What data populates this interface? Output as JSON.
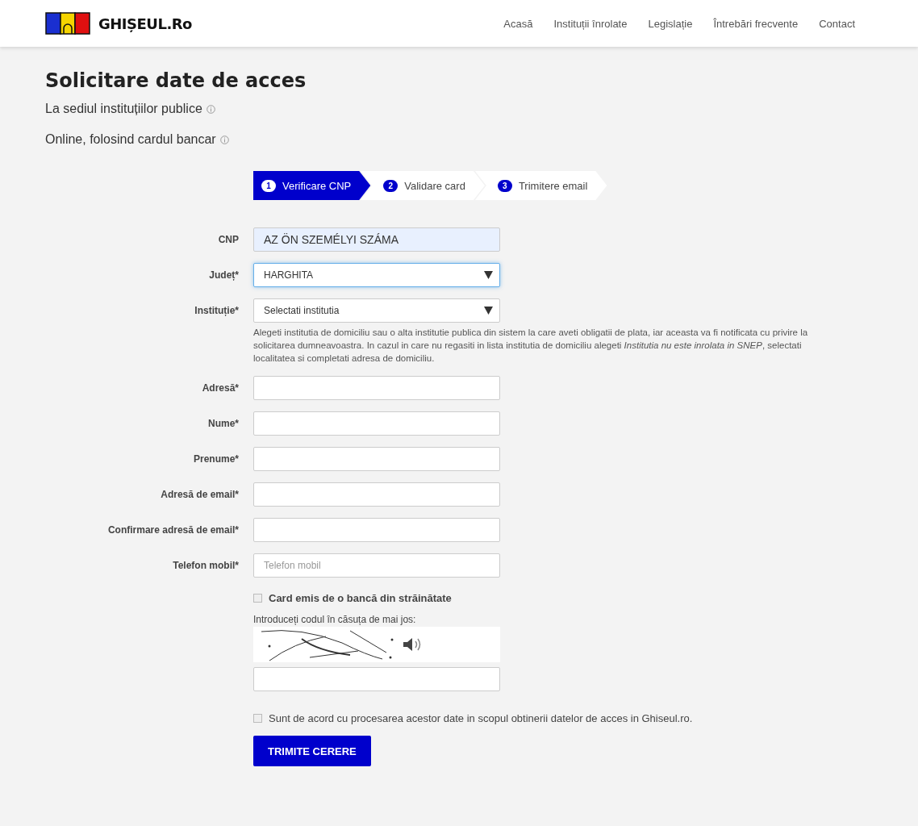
{
  "header": {
    "logo_text": "GHIȘEUL.Ro",
    "nav": [
      {
        "label": "Acasă"
      },
      {
        "label": "Instituții înrolate"
      },
      {
        "label": "Legislație"
      },
      {
        "label": "Întrebări frecvente"
      },
      {
        "label": "Contact"
      }
    ]
  },
  "title": "Solicitare date de acces",
  "options": [
    {
      "text": "La sediul instituțiilor publice"
    },
    {
      "text": "Online, folosind cardul bancar"
    }
  ],
  "steps": [
    {
      "number": "1",
      "label": "Verificare CNP",
      "selected": true
    },
    {
      "number": "2",
      "label": "Validare card",
      "selected": false
    },
    {
      "number": "3",
      "label": "Trimitere email",
      "selected": false
    }
  ],
  "fields": [
    {
      "kind": "text",
      "label": "CNP",
      "value": "AZ ÖN SZEMÉLYI SZÁMA",
      "autofilled": true,
      "focused": false
    },
    {
      "kind": "select",
      "label": "Județ*",
      "value": "HARGHITA",
      "focused": true
    },
    {
      "kind": "select",
      "label": "Instituție*",
      "value": "Selectati institutia",
      "focused": false,
      "help": "Alegeti institutia de domiciliu sau o alta institutie publica din sistem la care aveti obligatii de plata, iar aceasta va fi notificata cu privire la solicitarea dumneavoastra. In cazul in care nu regasiti in lista institutia de domiciliu alegeti *Institutia nu este inrolata in SNEP*, selectati localitatea si completati adresa de domiciliu."
    },
    {
      "kind": "text",
      "label": "Adresă*",
      "autofilled": false,
      "focused": false
    },
    {
      "kind": "text",
      "label": "Nume*",
      "autofilled": false,
      "focused": false
    },
    {
      "kind": "text",
      "label": "Prenume*",
      "autofilled": false,
      "focused": false
    },
    {
      "kind": "text",
      "label": "Adresă de email*",
      "autofilled": false,
      "focused": false
    },
    {
      "kind": "text",
      "label": "Confirmare adresă de email*",
      "autofilled": false,
      "focused": false
    },
    {
      "kind": "text",
      "label": "Telefon mobil*",
      "placeholder": "Telefon mobil",
      "autofilled": false,
      "focused": false
    }
  ],
  "foreign_card": {
    "label": "Card emis de o bancă din străinătate",
    "checked": false
  },
  "captcha": {
    "prompt": "Introduceți codul în căsuța de mai jos:"
  },
  "consent": {
    "label": "Sunt de acord cu procesarea acestor date in scopul obtinerii datelor de acces in Ghiseul.ro.",
    "checked": false
  },
  "submit": {
    "label": "TRIMITE CERERE"
  }
}
